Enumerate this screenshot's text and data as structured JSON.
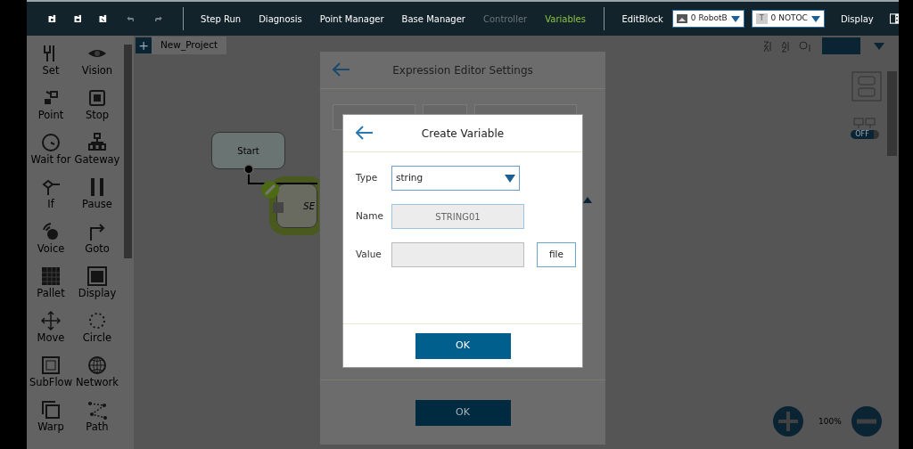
{
  "toolbar": {
    "menu": [
      {
        "label": "Step Run",
        "selected": false,
        "disabled": false
      },
      {
        "label": "Diagnosis",
        "selected": false,
        "disabled": false
      },
      {
        "label": "Point Manager",
        "selected": false,
        "disabled": false
      },
      {
        "label": "Base Manager",
        "selected": false,
        "disabled": false
      },
      {
        "label": "Controller",
        "selected": false,
        "disabled": true
      },
      {
        "label": "Variables",
        "selected": true,
        "disabled": false
      }
    ],
    "edit_block": "EditBlock",
    "base_select": {
      "value": "0 RobotB"
    },
    "tool_select": {
      "badge": "T",
      "value": "0 NOTOC"
    },
    "display": "Display"
  },
  "palette": [
    {
      "label": "Set"
    },
    {
      "label": "Vision"
    },
    {
      "label": "Point"
    },
    {
      "label": "Stop"
    },
    {
      "label": "Wait for"
    },
    {
      "label": "Gateway"
    },
    {
      "label": "If"
    },
    {
      "label": "Pause"
    },
    {
      "label": "Voice"
    },
    {
      "label": "Goto"
    },
    {
      "label": "Pallet"
    },
    {
      "label": "Display"
    },
    {
      "label": "Move"
    },
    {
      "label": "Circle"
    },
    {
      "label": "SubFlow"
    },
    {
      "label": "Network"
    },
    {
      "label": "Warp"
    },
    {
      "label": "Path"
    }
  ],
  "add_tab": "+",
  "project_tab": "New_Project",
  "canvas": {
    "nodes": [
      {
        "label": "Start"
      },
      {
        "label": "SE"
      }
    ],
    "toggle": {
      "label": "OFF",
      "on": false
    },
    "zoom": "100%"
  },
  "expression_dialog": {
    "title": "Expression Editor Settings",
    "ok": "OK"
  },
  "create_variable": {
    "title": "Create Variable",
    "fields": [
      {
        "kind": "select",
        "label": "Type",
        "value": "string"
      },
      {
        "kind": "readonly",
        "label": "Name",
        "value": "STRING01"
      },
      {
        "kind": "text",
        "label": "Value",
        "button": "file"
      }
    ],
    "ok": "OK"
  }
}
